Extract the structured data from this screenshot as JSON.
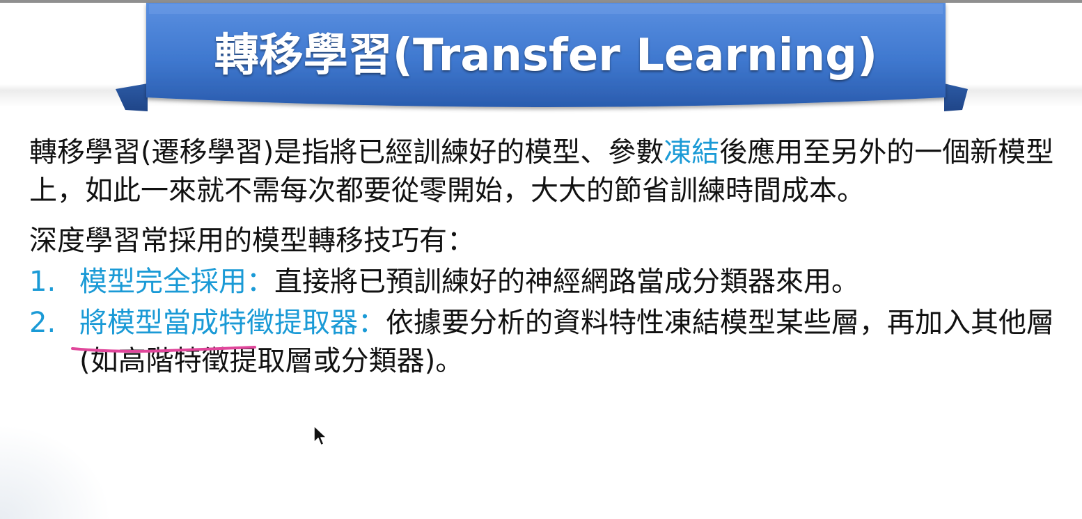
{
  "slide": {
    "title": "轉移學習(Transfer Learning)",
    "intro": {
      "before": "轉移學習(遷移學習)是指將已經訓練好的模型、參數",
      "highlight": "凍結",
      "after": "後應用至另外的一個新模型上，如此一來就不需每次都要從零開始，大大的節省訓練時間成本。"
    },
    "techniques_heading": "深度學習常採用的模型轉移技巧有：",
    "techniques": [
      {
        "number": "1.",
        "term": "模型完全採用",
        "separator": "：",
        "description": "直接將已預訓練好的神經網路當成分類器來用。"
      },
      {
        "number": "2.",
        "term": "將模型當成特徵提取器",
        "separator": "：",
        "description": "依據要分析的資料特性凍結模型某些層，再加入其他層(如高階特徵提取層或分類器)。"
      }
    ]
  },
  "colors": {
    "banner_blue": "#3f78cf",
    "accent_blue": "#1a9ad6",
    "underline_pink": "#e0479b",
    "body_text": "#111111"
  }
}
